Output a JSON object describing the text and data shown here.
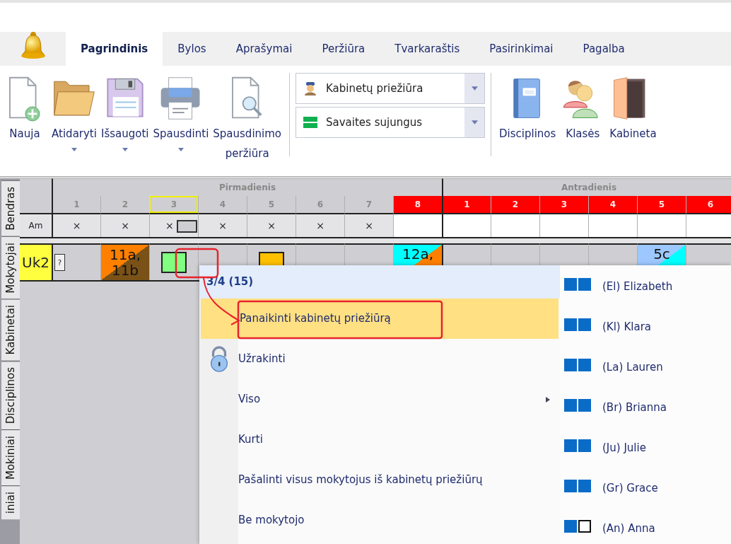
{
  "tabs": [
    {
      "label": "Pagrindinis",
      "selected": true
    },
    {
      "label": "Bylos",
      "selected": false
    },
    {
      "label": "Aprašymai",
      "selected": false
    },
    {
      "label": "Peržiūra",
      "selected": false
    },
    {
      "label": "Tvarkaraštis",
      "selected": false
    },
    {
      "label": "Pasirinkimai",
      "selected": false
    },
    {
      "label": "Pagalba",
      "selected": false
    }
  ],
  "ribbon": {
    "buttons": [
      {
        "label": "Nauja",
        "kind": "new",
        "dropdown": false
      },
      {
        "label": "Atidaryti",
        "kind": "open",
        "dropdown": true
      },
      {
        "label": "Išsaugoti",
        "kind": "save",
        "dropdown": true
      },
      {
        "label": "Spausdinti",
        "kind": "print",
        "dropdown": true
      },
      {
        "label": "Spausdinimo peržiūra",
        "kind": "preview",
        "dropdown": false
      }
    ],
    "combos": [
      {
        "value": "Kabinetų priežiūra",
        "kind": "supervisor"
      },
      {
        "value": "Savaites sujungus",
        "kind": "weeks"
      }
    ],
    "views": [
      {
        "label": "Disciplinos",
        "kind": "book"
      },
      {
        "label": "Klasės",
        "kind": "people"
      },
      {
        "label": "Kabineta",
        "kind": "door"
      }
    ]
  },
  "side_tabs": [
    {
      "label": "Bendras"
    },
    {
      "label": "Mokytojai"
    },
    {
      "label": "Kabinetai"
    },
    {
      "label": "Disciplinos"
    },
    {
      "label": "Mokiniai"
    },
    {
      "label": "iniai"
    }
  ],
  "timetable": {
    "days": [
      {
        "name": "Pirmadienis",
        "periods": [
          {
            "label": "1",
            "marked": false,
            "selected": false
          },
          {
            "label": "2",
            "marked": false,
            "selected": false
          },
          {
            "label": "3",
            "marked": false,
            "selected": true
          },
          {
            "label": "4",
            "marked": false,
            "selected": false
          },
          {
            "label": "5",
            "marked": false,
            "selected": false
          },
          {
            "label": "6",
            "marked": false,
            "selected": false
          },
          {
            "label": "7",
            "marked": false,
            "selected": false
          },
          {
            "label": "8",
            "marked": true,
            "selected": false
          }
        ]
      },
      {
        "name": "Antradienis",
        "periods": [
          {
            "label": "1",
            "marked": true,
            "selected": false
          },
          {
            "label": "2",
            "marked": true,
            "selected": false
          },
          {
            "label": "3",
            "marked": true,
            "selected": false
          },
          {
            "label": "4",
            "marked": true,
            "selected": false
          },
          {
            "label": "5",
            "marked": true,
            "selected": false
          },
          {
            "label": "6",
            "marked": true,
            "selected": false
          }
        ]
      }
    ],
    "rows": [
      {
        "label": "Am",
        "kind": "availability",
        "cells": [
          {
            "text": "×",
            "ghost": false
          },
          {
            "text": "×",
            "ghost": false
          },
          {
            "text": "×",
            "ghost": true
          },
          {
            "text": "×",
            "ghost": false
          },
          {
            "text": "×",
            "ghost": false
          },
          {
            "text": "×",
            "ghost": false
          },
          {
            "text": "×",
            "ghost": false
          },
          {},
          {},
          {},
          {},
          {},
          {},
          {}
        ]
      },
      {
        "label": "Uk2",
        "kind": "teacher",
        "cells": [
          {
            "kind": "unknown",
            "text": "?"
          },
          {
            "kind": "lesson",
            "text": "11a, 11b",
            "groups": [
              {
                "color": "#ff8000"
              },
              {
                "color": "#7a5217"
              }
            ]
          },
          {
            "kind": "small",
            "color": "#80ff80"
          },
          {},
          {
            "kind": "small",
            "color": "#ffc000"
          },
          {},
          {},
          {
            "kind": "lesson",
            "text": "12a,",
            "groups": [
              {
                "color": "#00ffff"
              },
              {
                "color": "#ff8000"
              }
            ]
          },
          {},
          {},
          {},
          {},
          {
            "kind": "lesson",
            "text": "5c",
            "groups": [
              {
                "color": "#9cc8ff"
              },
              {
                "color": "#00ffff"
              }
            ]
          },
          {}
        ]
      }
    ]
  },
  "context_menu": {
    "header": "3/4 (15)",
    "items": [
      {
        "label": "Panaikinti kabinetų priežiūrą",
        "highlighted": true,
        "kind": "plain",
        "submenu": false
      },
      {
        "label": "Užrakinti",
        "highlighted": false,
        "kind": "lock",
        "submenu": false
      },
      {
        "label": "Viso",
        "highlighted": false,
        "kind": "plain",
        "submenu": true
      },
      {
        "label": "Kurti",
        "highlighted": false,
        "kind": "plain",
        "submenu": false
      },
      {
        "label": "Pašalinti visus mokytojus iš kabinetų priežiūrų",
        "highlighted": false,
        "kind": "plain",
        "submenu": false
      },
      {
        "label": "Be mokytojo",
        "highlighted": false,
        "kind": "plain",
        "submenu": false
      }
    ],
    "teachers": [
      {
        "name": "(El) Elizabeth",
        "slots": [
          true,
          true
        ]
      },
      {
        "name": "(Kl) Klara",
        "slots": [
          true,
          true
        ]
      },
      {
        "name": "(La) Lauren",
        "slots": [
          true,
          true
        ]
      },
      {
        "name": "(Br) Brianna",
        "slots": [
          true,
          true
        ]
      },
      {
        "name": "(Ju) Julie",
        "slots": [
          true,
          true
        ]
      },
      {
        "name": "(Gr) Grace",
        "slots": [
          true,
          true
        ]
      },
      {
        "name": "(An) Anna",
        "slots": [
          true,
          false
        ]
      }
    ]
  }
}
